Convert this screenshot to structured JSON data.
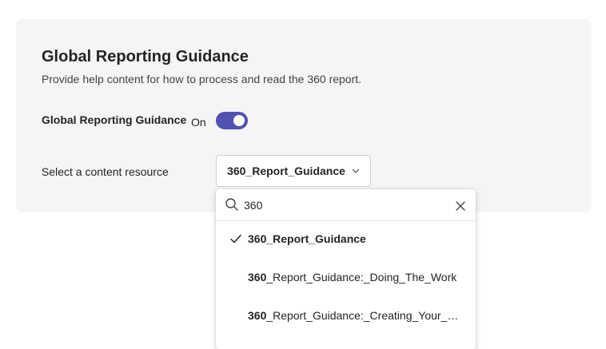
{
  "settings": {
    "title": "Global Reporting Guidance",
    "description": "Provide help content for how to process and read the 360 report.",
    "toggle": {
      "label": "Global Reporting Guidance",
      "state_text": "On",
      "on": true
    },
    "select": {
      "label": "Select a content resource",
      "value": "360_Report_Guidance"
    }
  },
  "dropdown": {
    "search_value": "360",
    "options": [
      {
        "match": "360",
        "rest": "_Report_Guidance",
        "selected": true
      },
      {
        "match": "360",
        "rest": "_Report_Guidance:_Doing_The_Work",
        "selected": false
      },
      {
        "match": "360",
        "rest": "_Report_Guidance:_Creating_Your_Positive_Impact",
        "selected": false
      }
    ]
  },
  "colors": {
    "accent": "#4f52b2",
    "card_bg": "#f5f5f5"
  }
}
